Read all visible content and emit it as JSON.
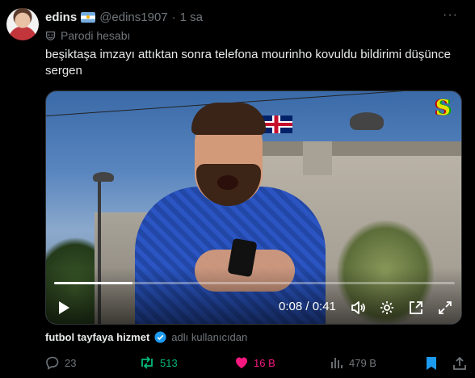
{
  "author": {
    "display_name": "edins",
    "flag": "argentina-flag-emoji",
    "handle": "@edins1907",
    "separator": "·",
    "timestamp": "1 sa"
  },
  "parody_label": "Parodi hesabı",
  "tweet_text": "beşiktaşa imzayı attıktan sonra telefona mourinho kovuldu bildirimi düşünce sergen",
  "video": {
    "watermark": "S",
    "time_display": "0:08 / 0:41",
    "progress": 0.195
  },
  "source": {
    "name": "futbol tayfaya hizmet",
    "suffix": "adlı kullanıcıdan"
  },
  "actions": {
    "replies": "23",
    "reposts": "513",
    "likes": "16 B",
    "views": "479 B"
  },
  "colors": {
    "repost_active": "#00ba7c",
    "like_active": "#f91880",
    "verified": "#1d9bf0",
    "bookmark_active": "#1d9bf0"
  }
}
